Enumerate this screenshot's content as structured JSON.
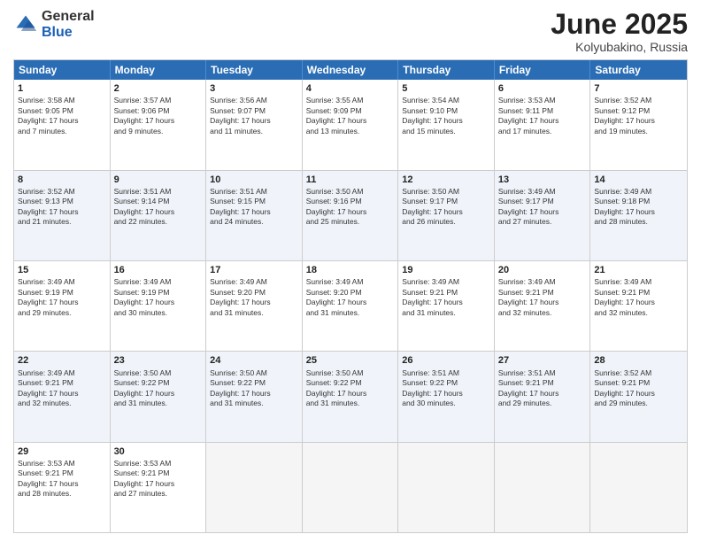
{
  "logo": {
    "general": "General",
    "blue": "Blue"
  },
  "title": "June 2025",
  "location": "Kolyubakino, Russia",
  "days": [
    "Sunday",
    "Monday",
    "Tuesday",
    "Wednesday",
    "Thursday",
    "Friday",
    "Saturday"
  ],
  "weeks": [
    [
      {
        "day": "1",
        "lines": [
          "Sunrise: 3:58 AM",
          "Sunset: 9:05 PM",
          "Daylight: 17 hours",
          "and 7 minutes."
        ],
        "shade": false
      },
      {
        "day": "2",
        "lines": [
          "Sunrise: 3:57 AM",
          "Sunset: 9:06 PM",
          "Daylight: 17 hours",
          "and 9 minutes."
        ],
        "shade": false
      },
      {
        "day": "3",
        "lines": [
          "Sunrise: 3:56 AM",
          "Sunset: 9:07 PM",
          "Daylight: 17 hours",
          "and 11 minutes."
        ],
        "shade": false
      },
      {
        "day": "4",
        "lines": [
          "Sunrise: 3:55 AM",
          "Sunset: 9:09 PM",
          "Daylight: 17 hours",
          "and 13 minutes."
        ],
        "shade": false
      },
      {
        "day": "5",
        "lines": [
          "Sunrise: 3:54 AM",
          "Sunset: 9:10 PM",
          "Daylight: 17 hours",
          "and 15 minutes."
        ],
        "shade": false
      },
      {
        "day": "6",
        "lines": [
          "Sunrise: 3:53 AM",
          "Sunset: 9:11 PM",
          "Daylight: 17 hours",
          "and 17 minutes."
        ],
        "shade": false
      },
      {
        "day": "7",
        "lines": [
          "Sunrise: 3:52 AM",
          "Sunset: 9:12 PM",
          "Daylight: 17 hours",
          "and 19 minutes."
        ],
        "shade": false
      }
    ],
    [
      {
        "day": "8",
        "lines": [
          "Sunrise: 3:52 AM",
          "Sunset: 9:13 PM",
          "Daylight: 17 hours",
          "and 21 minutes."
        ],
        "shade": true
      },
      {
        "day": "9",
        "lines": [
          "Sunrise: 3:51 AM",
          "Sunset: 9:14 PM",
          "Daylight: 17 hours",
          "and 22 minutes."
        ],
        "shade": true
      },
      {
        "day": "10",
        "lines": [
          "Sunrise: 3:51 AM",
          "Sunset: 9:15 PM",
          "Daylight: 17 hours",
          "and 24 minutes."
        ],
        "shade": true
      },
      {
        "day": "11",
        "lines": [
          "Sunrise: 3:50 AM",
          "Sunset: 9:16 PM",
          "Daylight: 17 hours",
          "and 25 minutes."
        ],
        "shade": true
      },
      {
        "day": "12",
        "lines": [
          "Sunrise: 3:50 AM",
          "Sunset: 9:17 PM",
          "Daylight: 17 hours",
          "and 26 minutes."
        ],
        "shade": true
      },
      {
        "day": "13",
        "lines": [
          "Sunrise: 3:49 AM",
          "Sunset: 9:17 PM",
          "Daylight: 17 hours",
          "and 27 minutes."
        ],
        "shade": true
      },
      {
        "day": "14",
        "lines": [
          "Sunrise: 3:49 AM",
          "Sunset: 9:18 PM",
          "Daylight: 17 hours",
          "and 28 minutes."
        ],
        "shade": true
      }
    ],
    [
      {
        "day": "15",
        "lines": [
          "Sunrise: 3:49 AM",
          "Sunset: 9:19 PM",
          "Daylight: 17 hours",
          "and 29 minutes."
        ],
        "shade": false
      },
      {
        "day": "16",
        "lines": [
          "Sunrise: 3:49 AM",
          "Sunset: 9:19 PM",
          "Daylight: 17 hours",
          "and 30 minutes."
        ],
        "shade": false
      },
      {
        "day": "17",
        "lines": [
          "Sunrise: 3:49 AM",
          "Sunset: 9:20 PM",
          "Daylight: 17 hours",
          "and 31 minutes."
        ],
        "shade": false
      },
      {
        "day": "18",
        "lines": [
          "Sunrise: 3:49 AM",
          "Sunset: 9:20 PM",
          "Daylight: 17 hours",
          "and 31 minutes."
        ],
        "shade": false
      },
      {
        "day": "19",
        "lines": [
          "Sunrise: 3:49 AM",
          "Sunset: 9:21 PM",
          "Daylight: 17 hours",
          "and 31 minutes."
        ],
        "shade": false
      },
      {
        "day": "20",
        "lines": [
          "Sunrise: 3:49 AM",
          "Sunset: 9:21 PM",
          "Daylight: 17 hours",
          "and 32 minutes."
        ],
        "shade": false
      },
      {
        "day": "21",
        "lines": [
          "Sunrise: 3:49 AM",
          "Sunset: 9:21 PM",
          "Daylight: 17 hours",
          "and 32 minutes."
        ],
        "shade": false
      }
    ],
    [
      {
        "day": "22",
        "lines": [
          "Sunrise: 3:49 AM",
          "Sunset: 9:21 PM",
          "Daylight: 17 hours",
          "and 32 minutes."
        ],
        "shade": true
      },
      {
        "day": "23",
        "lines": [
          "Sunrise: 3:50 AM",
          "Sunset: 9:22 PM",
          "Daylight: 17 hours",
          "and 31 minutes."
        ],
        "shade": true
      },
      {
        "day": "24",
        "lines": [
          "Sunrise: 3:50 AM",
          "Sunset: 9:22 PM",
          "Daylight: 17 hours",
          "and 31 minutes."
        ],
        "shade": true
      },
      {
        "day": "25",
        "lines": [
          "Sunrise: 3:50 AM",
          "Sunset: 9:22 PM",
          "Daylight: 17 hours",
          "and 31 minutes."
        ],
        "shade": true
      },
      {
        "day": "26",
        "lines": [
          "Sunrise: 3:51 AM",
          "Sunset: 9:22 PM",
          "Daylight: 17 hours",
          "and 30 minutes."
        ],
        "shade": true
      },
      {
        "day": "27",
        "lines": [
          "Sunrise: 3:51 AM",
          "Sunset: 9:21 PM",
          "Daylight: 17 hours",
          "and 29 minutes."
        ],
        "shade": true
      },
      {
        "day": "28",
        "lines": [
          "Sunrise: 3:52 AM",
          "Sunset: 9:21 PM",
          "Daylight: 17 hours",
          "and 29 minutes."
        ],
        "shade": true
      }
    ],
    [
      {
        "day": "29",
        "lines": [
          "Sunrise: 3:53 AM",
          "Sunset: 9:21 PM",
          "Daylight: 17 hours",
          "and 28 minutes."
        ],
        "shade": false
      },
      {
        "day": "30",
        "lines": [
          "Sunrise: 3:53 AM",
          "Sunset: 9:21 PM",
          "Daylight: 17 hours",
          "and 27 minutes."
        ],
        "shade": false
      },
      {
        "day": "",
        "lines": [],
        "shade": false,
        "empty": true
      },
      {
        "day": "",
        "lines": [],
        "shade": false,
        "empty": true
      },
      {
        "day": "",
        "lines": [],
        "shade": false,
        "empty": true
      },
      {
        "day": "",
        "lines": [],
        "shade": false,
        "empty": true
      },
      {
        "day": "",
        "lines": [],
        "shade": false,
        "empty": true
      }
    ]
  ]
}
